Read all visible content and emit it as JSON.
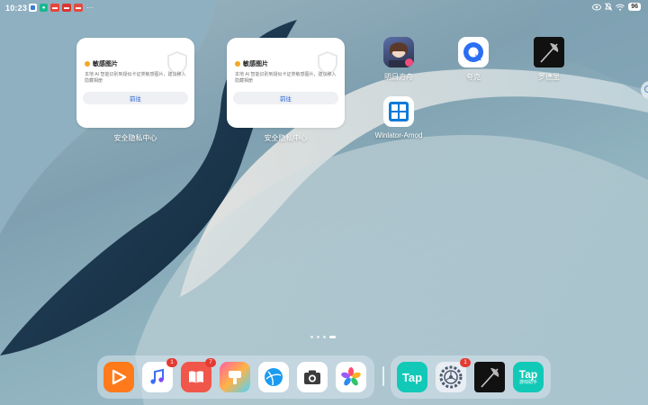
{
  "status_bar": {
    "time": "10:23",
    "battery": "96",
    "colors": {
      "text": "#ffffff"
    }
  },
  "widgets": [
    {
      "title": "敏感图片",
      "description": "本地 AI 智能识别到疑似卡证类敏感图片，建议移入隐藏相册",
      "button": "前往",
      "label": "安全隐私中心"
    },
    {
      "title": "敏感图片",
      "description": "本地 AI 智能识别到疑似卡证类敏感图片，建议移入隐藏相册",
      "button": "前往",
      "label": "安全隐私中心"
    }
  ],
  "apps": [
    {
      "label": "明日方舟",
      "icon": "arknights-game-icon"
    },
    {
      "label": "夸克",
      "icon": "quark-browser-icon"
    },
    {
      "label": "罗德里",
      "icon": "axe-app-icon"
    },
    {
      "label": "Winlator-Amod",
      "icon": "windows-emulator-icon"
    }
  ],
  "pager": {
    "total": 4,
    "active": 4
  },
  "dock": {
    "left": [
      {
        "name": "video-app-icon",
        "badge": ""
      },
      {
        "name": "music-app-icon",
        "badge": "1"
      },
      {
        "name": "books-app-icon",
        "badge": "7"
      },
      {
        "name": "themes-app-icon",
        "badge": ""
      },
      {
        "name": "browser-app-icon",
        "badge": ""
      },
      {
        "name": "camera-app-icon",
        "badge": ""
      },
      {
        "name": "gallery-app-icon",
        "badge": ""
      }
    ],
    "right": [
      {
        "name": "taptap-app-icon",
        "text": "Tap",
        "badge": ""
      },
      {
        "name": "settings-app-icon",
        "badge": "1"
      },
      {
        "name": "axe-game-icon",
        "badge": ""
      },
      {
        "name": "taptap-assistant-app-icon",
        "text": "Tap",
        "subtext": "游戏助手",
        "badge": ""
      }
    ]
  },
  "colors": {
    "accent_blue": "#1e5bd6",
    "warning_dot": "#f5a623",
    "badge_red": "#e33a32",
    "tap_teal": "#12c9b8"
  }
}
